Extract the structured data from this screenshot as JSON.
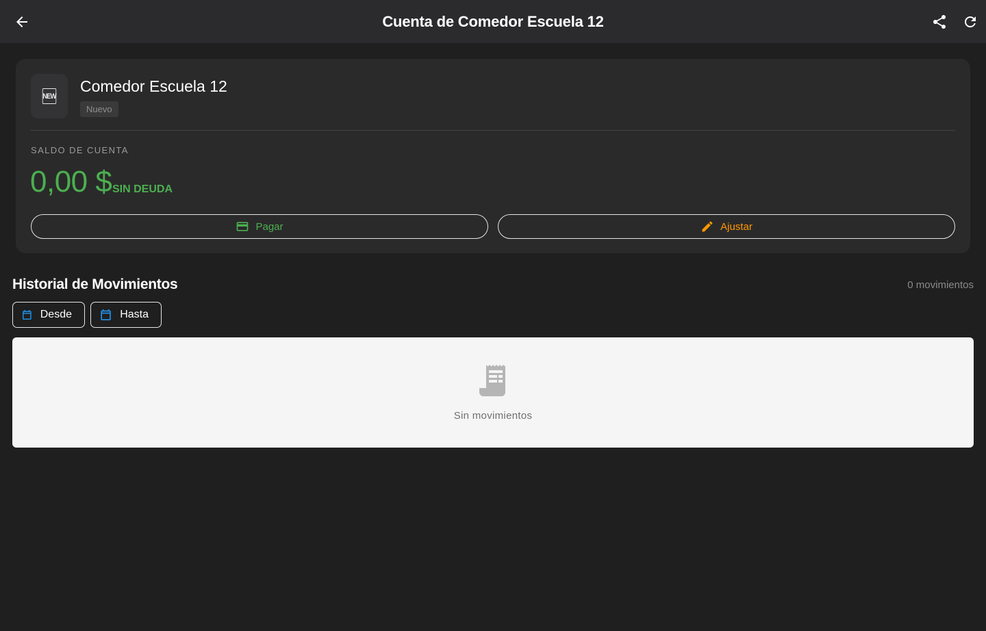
{
  "appbar": {
    "title": "Cuenta de Comedor Escuela 12",
    "back_icon": "arrow-left-icon",
    "share_icon": "share-icon",
    "refresh_icon": "refresh-icon"
  },
  "account": {
    "avatar_text": "NEW",
    "name": "Comedor Escuela 12",
    "status": "Nuevo",
    "balance_label": "SALDO DE CUENTA",
    "balance_amount": "0,00 $",
    "balance_status": "SIN DEUDA"
  },
  "actions": {
    "pay_label": "Pagar",
    "adjust_label": "Ajustar"
  },
  "history": {
    "title": "Historial de Movimientos",
    "count": "0 movimientos",
    "from_label": "Desde",
    "to_label": "Hasta",
    "empty_text": "Sin movimientos"
  },
  "colors": {
    "positive": "#4caf50",
    "warning": "#ff9800",
    "accent": "#2196f3",
    "background": "#1f1f1f",
    "surface": "#2a2a2a"
  }
}
